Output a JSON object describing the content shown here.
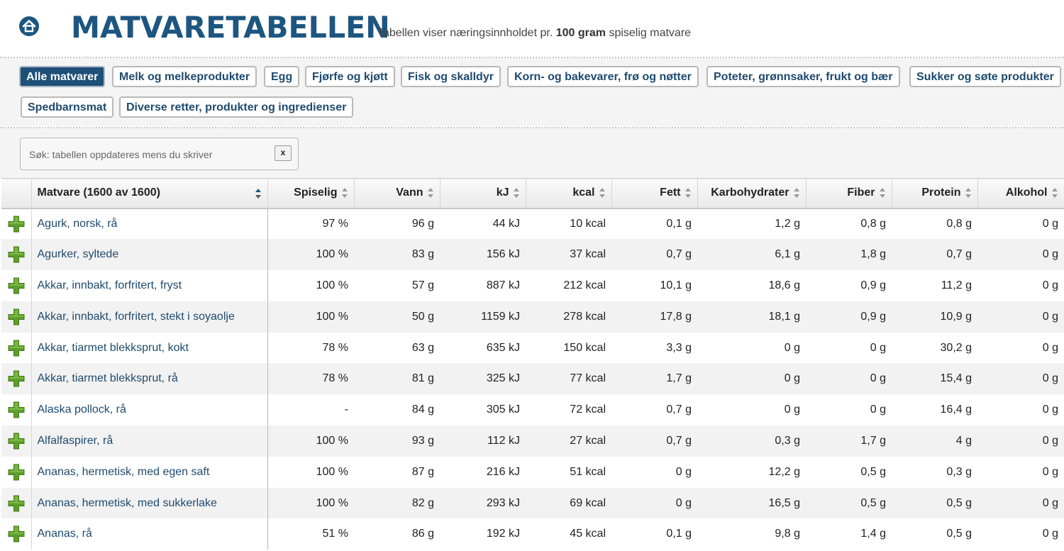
{
  "header": {
    "logo": "MATVARETABELLEN",
    "tagline_pre": "Tabellen viser næringsinnholdet pr.",
    "tagline_bold": "100 gram",
    "tagline_post": "spiselig matvare"
  },
  "categories": [
    {
      "label": "Alle matvarer",
      "active": true
    },
    {
      "label": "Melk og melkeprodukter"
    },
    {
      "label": "Egg"
    },
    {
      "label": "Fjørfe og kjøtt"
    },
    {
      "label": "Fisk og skalldyr"
    },
    {
      "label": "Korn- og bakevarer, frø og nøtter"
    },
    {
      "label": "Poteter, grønnsaker, frukt og bær"
    },
    {
      "label": "Sukker og søte produkter"
    },
    {
      "label": "Spedbarnsmat"
    },
    {
      "label": "Diverse retter, produkter og ingredienser"
    }
  ],
  "search": {
    "placeholder": "Søk: tabellen oppdateres mens du skriver",
    "clear_label": "x"
  },
  "table": {
    "columns": [
      "Matvare (1600 av 1600)",
      "Spiselig",
      "Vann",
      "kJ",
      "kcal",
      "Fett",
      "Karbohydrater",
      "Fiber",
      "Protein",
      "Alkohol"
    ],
    "rows": [
      [
        "Agurk, norsk, rå",
        "97 %",
        "96 g",
        "44 kJ",
        "10 kcal",
        "0,1 g",
        "1,2 g",
        "0,8 g",
        "0,8 g",
        "0 g"
      ],
      [
        "Agurker, syltede",
        "100 %",
        "83 g",
        "156 kJ",
        "37 kcal",
        "0,7 g",
        "6,1 g",
        "1,8 g",
        "0,7 g",
        "0 g"
      ],
      [
        "Akkar, innbakt, forfritert, fryst",
        "100 %",
        "57 g",
        "887 kJ",
        "212 kcal",
        "10,1 g",
        "18,6 g",
        "0,9 g",
        "11,2 g",
        "0 g"
      ],
      [
        "Akkar, innbakt, forfritert, stekt i soyaolje",
        "100 %",
        "50 g",
        "1159 kJ",
        "278 kcal",
        "17,8 g",
        "18,1 g",
        "0,9 g",
        "10,9 g",
        "0 g"
      ],
      [
        "Akkar, tiarmet blekksprut, kokt",
        "78 %",
        "63 g",
        "635 kJ",
        "150 kcal",
        "3,3 g",
        "0 g",
        "0 g",
        "30,2 g",
        "0 g"
      ],
      [
        "Akkar, tiarmet blekksprut, rå",
        "78 %",
        "81 g",
        "325 kJ",
        "77 kcal",
        "1,7 g",
        "0 g",
        "0 g",
        "15,4 g",
        "0 g"
      ],
      [
        "Alaska pollock, rå",
        "-",
        "84 g",
        "305 kJ",
        "72 kcal",
        "0,7 g",
        "0 g",
        "0 g",
        "16,4 g",
        "0 g"
      ],
      [
        "Alfalfaspirer, rå",
        "100 %",
        "93 g",
        "112 kJ",
        "27 kcal",
        "0,7 g",
        "0,3 g",
        "1,7 g",
        "4 g",
        "0 g"
      ],
      [
        "Ananas, hermetisk, med egen saft",
        "100 %",
        "87 g",
        "216 kJ",
        "51 kcal",
        "0 g",
        "12,2 g",
        "0,5 g",
        "0,3 g",
        "0 g"
      ],
      [
        "Ananas, hermetisk, med sukkerlake",
        "100 %",
        "82 g",
        "293 kJ",
        "69 kcal",
        "0 g",
        "16,5 g",
        "0,5 g",
        "0,5 g",
        "0 g"
      ],
      [
        "Ananas, rå",
        "51 %",
        "86 g",
        "192 kJ",
        "45 kcal",
        "0,1 g",
        "9,8 g",
        "1,4 g",
        "0,5 g",
        "0 g"
      ]
    ]
  },
  "icons": {
    "home": "home-icon",
    "add": "plus-icon",
    "sort": "sort-arrows-icon"
  },
  "colors": {
    "brand": "#1d5680",
    "add_icon": "#5a9a2a",
    "active_tab": "#1e5078"
  }
}
